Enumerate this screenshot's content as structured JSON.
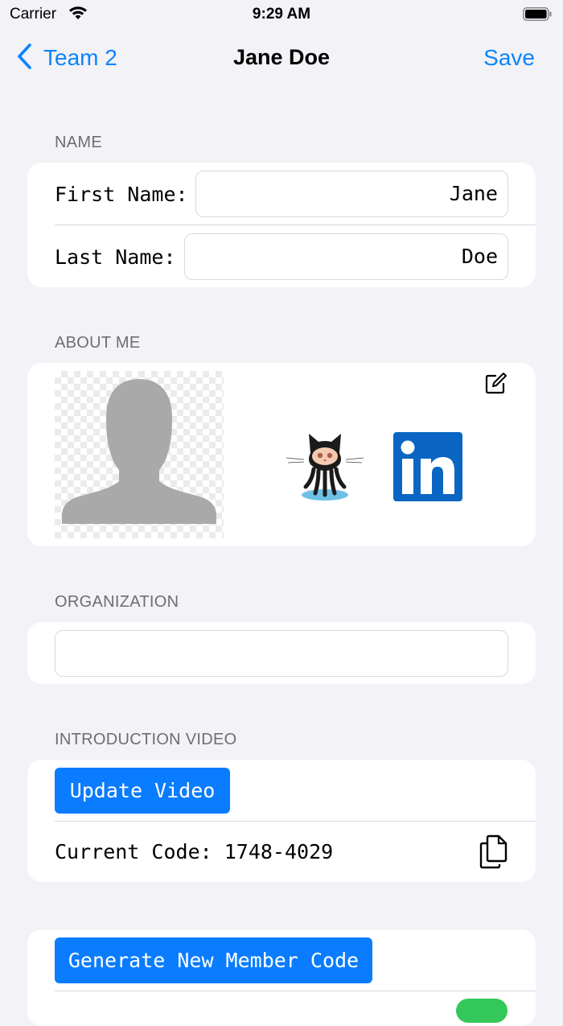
{
  "status_bar": {
    "carrier": "Carrier",
    "time": "9:29 AM"
  },
  "nav": {
    "back_label": "Team 2",
    "title": "Jane Doe",
    "save_label": "Save"
  },
  "name_section": {
    "header": "NAME",
    "first_label": "First Name:",
    "first_value": "Jane",
    "last_label": "Last Name:",
    "last_value": "Doe"
  },
  "about_section": {
    "header": "ABOUT ME",
    "icons": [
      "avatar-placeholder",
      "github-octocat",
      "linkedin",
      "edit-icon"
    ]
  },
  "organization_section": {
    "header": "ORGANIZATION",
    "value": ""
  },
  "video_section": {
    "header": "INTRODUCTION VIDEO",
    "update_button": "Update Video",
    "current_code_label": "Current Code: 1748-4029"
  },
  "member_section": {
    "generate_button": "Generate New Member Code"
  },
  "colors": {
    "accent": "#0a84ff",
    "button": "#0a7cff",
    "background": "#f2f2f7",
    "linkedin": "#0a66c2"
  }
}
